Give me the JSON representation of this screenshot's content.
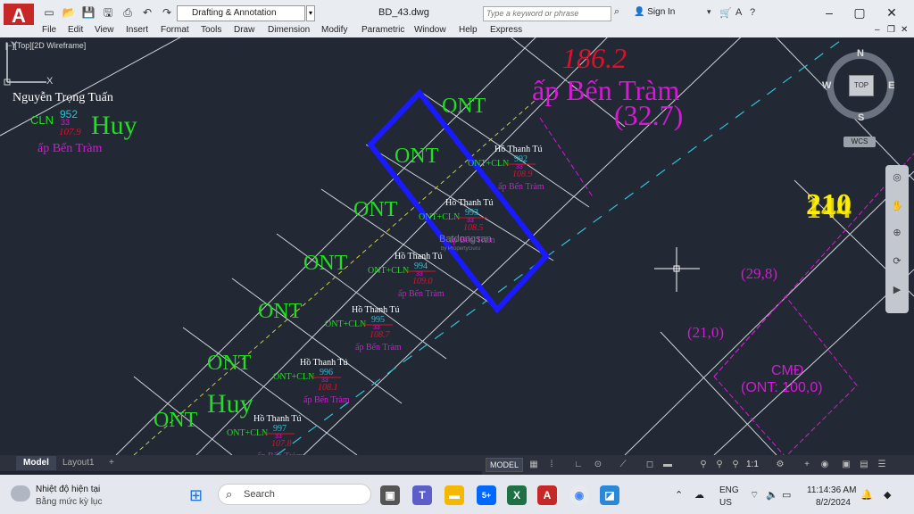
{
  "app": {
    "logo": "A",
    "workspace": "Drafting & Annotation",
    "title": "BD_43.dwg",
    "search_placeholder": "Type a keyword or phrase",
    "signin": "Sign In"
  },
  "menu": [
    "File",
    "Edit",
    "View",
    "Insert",
    "Format",
    "Tools",
    "Draw",
    "Dimension",
    "Modify",
    "Parametric",
    "Window",
    "Help",
    "Express"
  ],
  "viewport_label": "[−][Top][2D Wireframe]",
  "drawing": {
    "top_value": "186.2",
    "hamlet_big": "ấp Bến Tràm",
    "area_big": "(32.7)",
    "left_owner": "Nguyễn Trọng Tuấn",
    "left_code": "CLN",
    "left_parcel": "952",
    "left_sheet": "33",
    "left_area": "107.9",
    "left_hamlet": "ấp Bến Tràm",
    "huy": "Huy",
    "ont": "ONT",
    "owner": "Hồ Thanh Tú",
    "use_code": "ONT+CLN",
    "sheet": "33",
    "hamlet": "ấp Bến Tràm",
    "parcels": [
      {
        "id": "992",
        "area": "108.9"
      },
      {
        "id": "993",
        "area": "108.5"
      },
      {
        "id": "994",
        "area": "109.0"
      },
      {
        "id": "995",
        "area": "108.7"
      },
      {
        "id": "996",
        "area": "108.1"
      },
      {
        "id": "997",
        "area": "107.8"
      }
    ],
    "yellow_a": "210",
    "yellow_b": "144",
    "area_a": "(29,8)",
    "area_b": "(21,0)",
    "cmd_label": "CMĐ",
    "cmd_sub": "(ONT: 100,0)",
    "watermark": "Batdongsan",
    "watermark_sub": "by PropertyGuru"
  },
  "viewcube": {
    "top": "TOP",
    "n": "N",
    "s": "S",
    "e": "E",
    "w": "W",
    "wcs": "WCS"
  },
  "ucs": {
    "x": "X",
    "y": "Y"
  },
  "layout_tabs": [
    "Model",
    "Layout1"
  ],
  "status": {
    "model": "MODEL",
    "scale": "1:1"
  },
  "taskbar": {
    "weather_title": "Nhiệt độ hiện tại",
    "weather_sub": "Bằng mức kỳ lục",
    "search": "Search",
    "lang1": "ENG",
    "lang2": "US",
    "time": "11:14:36 AM",
    "date": "8/2/2024",
    "zalo_badge": "5+"
  },
  "colors": {
    "blue_box": "#1a1aff",
    "cyan": "#2ec4d6",
    "green": "#22dd22",
    "magenta": "#d619d6",
    "red": "#e0102a",
    "yellow": "#ffee00"
  }
}
